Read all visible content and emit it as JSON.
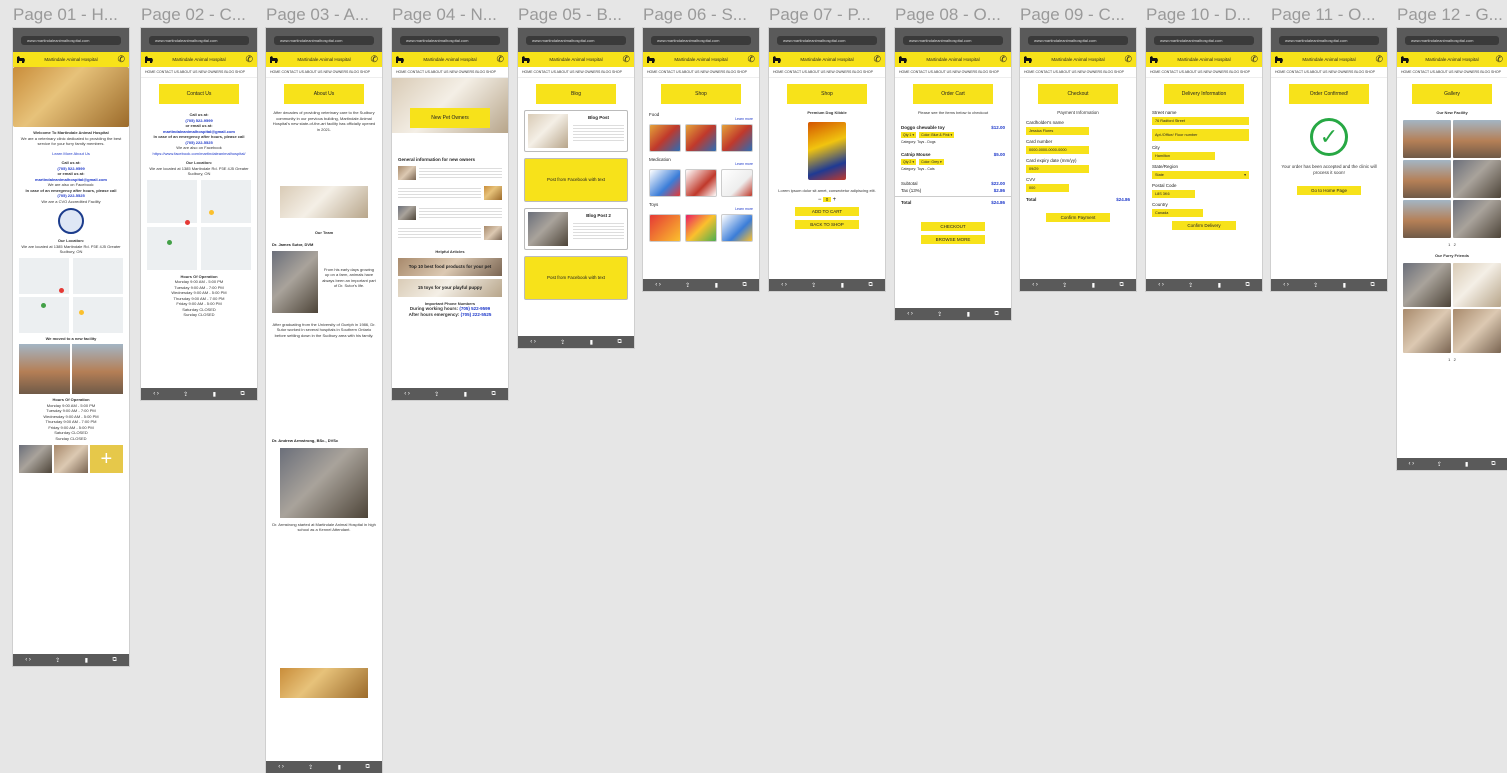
{
  "frames": [
    {
      "title": "Page 01 - H..."
    },
    {
      "title": "Page 02 - C..."
    },
    {
      "title": "Page 03 - A..."
    },
    {
      "title": "Page 04 - N..."
    },
    {
      "title": "Page 05 - B..."
    },
    {
      "title": "Page 06 - S..."
    },
    {
      "title": "Page 07 - P..."
    },
    {
      "title": "Page 08 - O..."
    },
    {
      "title": "Page 09 - C..."
    },
    {
      "title": "Page 10 - D..."
    },
    {
      "title": "Page 11 - O..."
    },
    {
      "title": "Page 12 - G..."
    }
  ],
  "common": {
    "url": "www.martindaleanimalhospital.com",
    "brand": "Martindale Animal Hospital",
    "nav": "HOME  CONTACT US  ABOUT US  NEW OWNERS  BLOG  SHOP",
    "phone_icon": "phone-icon",
    "accent": "#f7e21a"
  },
  "p01": {
    "welcome": "Welcome To Martindale Animal Hospital",
    "intro": "We are a veterinary clinic dedicated to providing the best service for your furry family members.",
    "learn_more": "Learn More About Us",
    "call": "Call us at:",
    "phone": "(705) 522-9599",
    "email_label": "or email us at:",
    "email": "martindaleanimalhospital@gmail.com",
    "facebook": "We are also on Facebook:",
    "emergency": "In case of an emergency after hours, please call",
    "emergency_phone": "(705) 222-5525",
    "cvo": "We are a CVO Accredited Facility",
    "location_label": "Our Location:",
    "location": "We are located at 1385 Martindale Rd. P3E 4J5 Greater Sudbury, ON",
    "moved": "We moved to a new facility",
    "hours_title": "Hours Of Operation",
    "hours": [
      "Monday 9:00 AM - 5:00 PM",
      "Tuesday 9:00 AM - 7:00 PM",
      "Wednesday 9:00 AM - 5:00 PM",
      "Thursday 9:00 AM - 7:00 PM",
      "Friday 9:00 AM - 5:00 PM",
      "Saturday CLOSED",
      "Sunday CLOSED"
    ]
  },
  "p02": {
    "title": "Contact Us",
    "call": "Call us at:",
    "phone": "(705) 522-9599",
    "email_label": "or email us at:",
    "email": "martindaleanimalhospital@gmail.com",
    "emergency": "In case of an emergency after hours, please call",
    "emergency_phone": "(705) 222-5525",
    "facebook": "We are also on Facebook",
    "facebook_url": "https://www.facebook.com/martindaleanimalhospital/",
    "location_label": "Our Location:",
    "location": "We are located at 1385 Martindale Rd. P3E 4J5 Greater Sudbury, ON",
    "hours_title": "Hours Of Operation",
    "hours": [
      "Monday 9:00 AM - 5:00 PM",
      "Tuesday 9:00 AM - 7:00 PM",
      "Wednesday 9:00 AM - 5:00 PM",
      "Thursday 9:00 AM - 7:00 PM",
      "Friday 9:00 AM - 5:00 PM",
      "Saturday CLOSED",
      "Sunday CLOSED"
    ]
  },
  "p03": {
    "title": "About Us",
    "intro": "After decades of providing veterinary care to the Sudbury community in our previous building, Martindale Animal Hospital's new state-of-the-art facility has officially opened in 2021.",
    "team": "Our Team",
    "vet1": "Dr. James Sutor, DVM",
    "vet1_text": "From his early days growing up on a farm, animals have always been an important part of Dr. Sutor's life.",
    "vet1_more": "After graduating from the University of Guelph in 1986, Dr. Sutor worked in several hospitals in Southern Ontario before settling down in the Sudbury area with his family.",
    "vet2": "Dr. Andrew Armstrong, BSc., DVSc",
    "vet2_text": "Dr. Armstrong started at Martindale Animal Hospital in high school as a Kennel Attendant."
  },
  "p04": {
    "title": "New Pet Owners",
    "general": "General information for new owners",
    "helpful": "Helpful Articles",
    "article1": "Top 10 best food products for your pet",
    "article2": "15 toys for your playful puppy",
    "important": "Important Phone Numbers",
    "working": "During working hours:",
    "working_phone": "(705) 522-9599",
    "after": "After hours emergency:",
    "after_phone": "(705) 222-5525"
  },
  "p05": {
    "title": "Blog",
    "post1": "Blog Post",
    "fb1": "Post from Facebook with text",
    "post2": "Blog Post 2",
    "fb2": "Post from Facebook with text"
  },
  "p06": {
    "title": "Shop",
    "food": "Food",
    "medication": "Medication",
    "toys": "Toys",
    "learn_more": "Learn more"
  },
  "p07": {
    "title": "Shop",
    "product": "Premium Dog Kibble",
    "desc": "Lorem ipsum dolor sit amet, consectetur adipiscing elit.",
    "qty": "0",
    "add": "ADD TO CART",
    "back": "BACK TO SHOP"
  },
  "p08": {
    "title": "Order Cart",
    "subtitle": "Please see the items below to checkout",
    "item1": "Doggo chewable toy",
    "item1_price": "$12.00",
    "item1_cat": "Category: Toys - Dogs",
    "item2": "Catnip Mouse",
    "item2_price": "$5.00",
    "item2_cat": "Category: Toys - Cats",
    "subtotal": "Subtotal",
    "subtotal_v": "$22.00",
    "tax": "Tax (13%)",
    "tax_v": "$2.86",
    "total": "Total",
    "total_v": "$24.86",
    "checkout": "CHECKOUT",
    "browse": "BROWSE MORE"
  },
  "p09": {
    "title": "Checkout",
    "payment": "Payment Information",
    "holder": "Cardholder's name",
    "holder_v": "Jessica Flores",
    "number": "Card number",
    "number_v": "0000-0000-0000-0000",
    "expiry": "Card expiry date (mm/yy)",
    "expiry_v": "09/29",
    "cvv": "CVV",
    "cvv_v": "000",
    "total": "Total",
    "total_v": "$24.86",
    "confirm": "Confirm Payment"
  },
  "p10": {
    "title": "Delivery Information",
    "street": "Street name",
    "street_v": "76 Radford Street",
    "apt_v": "Apt./Office/ Floor number",
    "city": "City",
    "city_v": "Hamilton",
    "state": "State/Region",
    "state_v": "State",
    "postal": "Postal Code",
    "postal_v": "L8S 3K6",
    "country": "Country",
    "country_v": "Canada",
    "confirm": "Confirm Delivery"
  },
  "p11": {
    "title": "Order Confirmed!",
    "text": "Your order has been accepted and the clinic will process it soon!",
    "home": "Go to Home Page"
  },
  "p12": {
    "title": "Gallery",
    "facility": "Our New Facility",
    "pages": "1   2",
    "friends": "Our Furry Friends",
    "pages2": "1   2"
  }
}
